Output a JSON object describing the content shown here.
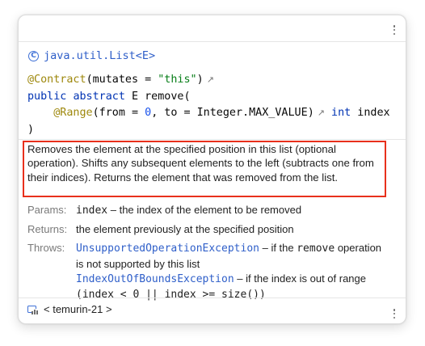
{
  "header": {
    "class_name": "java.util.List<E>",
    "class_icon_glyph": "C"
  },
  "signature": {
    "line1": {
      "annotation": "@Contract",
      "open": "(mutates = ",
      "value": "\"this\"",
      "close": ")"
    },
    "line2": {
      "kw1": "public",
      "kw2": "abstract",
      "type": "E",
      "name": "remove",
      "paren": "("
    },
    "line3": {
      "indent": "    ",
      "annotation": "@Range",
      "p1": "(from = ",
      "from": "0",
      "p2": ", to = ",
      "to": "Integer.MAX_VALUE",
      "p3": ")",
      "param_type": "int",
      "param_name": "index"
    },
    "line4": ")",
    "external_link_glyph": "↗"
  },
  "description": "Removes the element at the specified position in this list (optional operation). Shifts any subsequent elements to the left (subtracts one from their indices). Returns the element that was removed from the list.",
  "tags": {
    "params_label": "Params:",
    "params_name": "index",
    "params_text": " – the index of the element to be removed",
    "returns_label": "Returns:",
    "returns_text": "the element previously at the specified position",
    "throws_label": "Throws:",
    "throws1_exception": "UnsupportedOperationException",
    "throws1_text_a": " – if the ",
    "throws1_code": "remove",
    "throws1_text_b": " operation is not supported by this list",
    "throws2_exception": "IndexOutOfBoundsException",
    "throws2_text": " – if the index is out of range",
    "throws2_code": "(index < 0 || index >= size())"
  },
  "footer": {
    "sdk_label": "< temurin-21 >"
  },
  "colors": {
    "highlight_border": "#e8301c",
    "link": "#2f5fc9"
  }
}
